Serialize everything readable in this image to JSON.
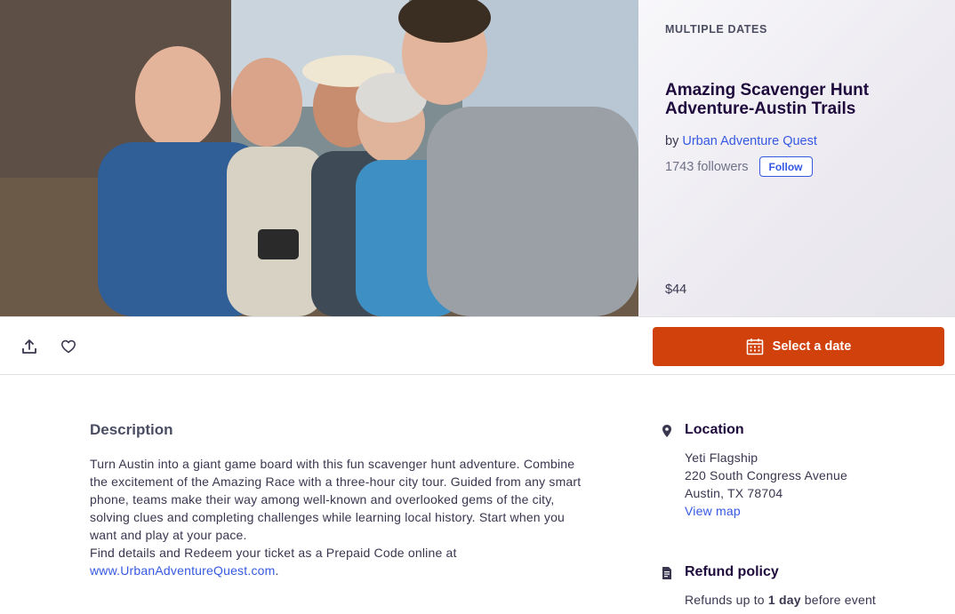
{
  "hero": {
    "date_label": "MULTIPLE DATES",
    "title": "Amazing Scavenger Hunt Adventure-Austin Trails",
    "by_prefix": "by",
    "organizer": "Urban Adventure Quest",
    "followers": "1743 followers",
    "follow_label": "Follow",
    "price": "$44"
  },
  "actions": {
    "select_date_label": "Select a date"
  },
  "description": {
    "heading": "Description",
    "paragraph1": "Turn Austin into a giant game board with this fun scavenger hunt adventure. Combine the excitement of the Amazing Race with a three-hour city tour. Guided from any smart phone, teams make their way among well-known and overlooked gems of the city, solving clues and completing challenges while learning local history. Start when you want and play at your pace.",
    "paragraph2_prefix": "Find details and Redeem your ticket as a Prepaid Code online at",
    "link": "www.UrbanAdventureQuest.com",
    "link_suffix": "."
  },
  "location": {
    "heading": "Location",
    "venue": "Yeti Flagship",
    "street": "220 South Congress Avenue",
    "city": "Austin, TX 78704",
    "map_link": "View map"
  },
  "refund": {
    "heading": "Refund policy",
    "prefix": "Refunds up to",
    "bold": "1 day",
    "suffix": "before event"
  },
  "icons": {
    "share": "share-icon",
    "like": "heart-icon",
    "calendar": "calendar-icon",
    "location": "map-pin-icon",
    "refund": "document-icon"
  },
  "colors": {
    "accent": "#d1410c",
    "link": "#3659e3",
    "title": "#1e0a3c"
  }
}
